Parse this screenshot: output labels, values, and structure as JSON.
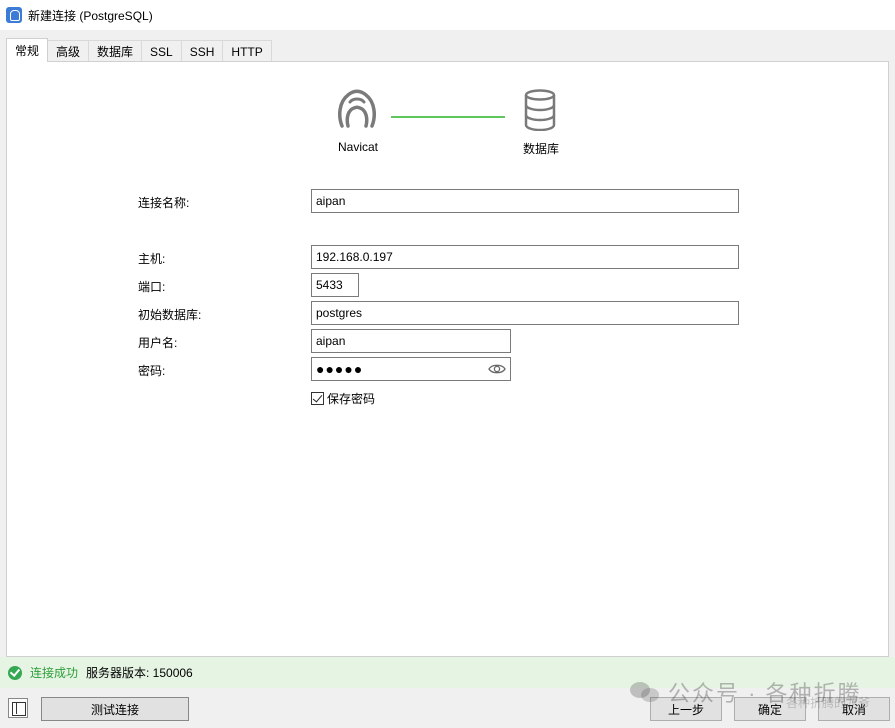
{
  "window": {
    "title": "新建连接 (PostgreSQL)"
  },
  "tabs": [
    {
      "label": "常规",
      "active": true
    },
    {
      "label": "高级"
    },
    {
      "label": "数据库"
    },
    {
      "label": "SSL"
    },
    {
      "label": "SSH"
    },
    {
      "label": "HTTP"
    }
  ],
  "diagram": {
    "left_label": "Navicat",
    "right_label": "数据库",
    "line_color": "#5ec85a"
  },
  "form": {
    "connection_name": {
      "label": "连接名称:",
      "value": "aipan"
    },
    "host": {
      "label": "主机:",
      "value": "192.168.0.197"
    },
    "port": {
      "label": "端口:",
      "value": "5433"
    },
    "initial_db": {
      "label": "初始数据库:",
      "value": "postgres"
    },
    "username": {
      "label": "用户名:",
      "value": "aipan"
    },
    "password": {
      "label": "密码:",
      "value": "●●●●●"
    },
    "save_password": {
      "label": "保存密码",
      "checked": true
    }
  },
  "status": {
    "success": "连接成功",
    "server_version": "服务器版本: 150006",
    "color": "#2e9e3a"
  },
  "buttons": {
    "test": "测试连接",
    "prev": "上一步",
    "ok": "确定",
    "cancel": "取消"
  },
  "watermark": {
    "text": "公众号 · 各种折腾",
    "sub": "各种折腾的龙爷"
  }
}
